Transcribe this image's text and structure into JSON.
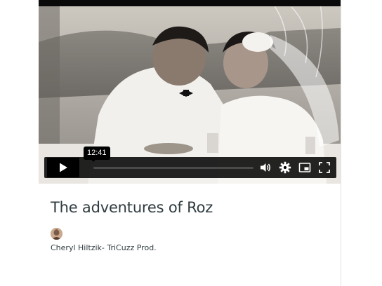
{
  "video": {
    "time_tooltip": "12:41",
    "progress": 0.0,
    "icons": {
      "play": "play-icon",
      "volume": "volume-icon",
      "settings": "gear-icon",
      "pip": "picture-in-picture-icon",
      "fullscreen": "fullscreen-icon"
    }
  },
  "title": "The adventures of Roz",
  "author": {
    "name": "Cheryl Hiltzik- TriCuzz Prod."
  }
}
